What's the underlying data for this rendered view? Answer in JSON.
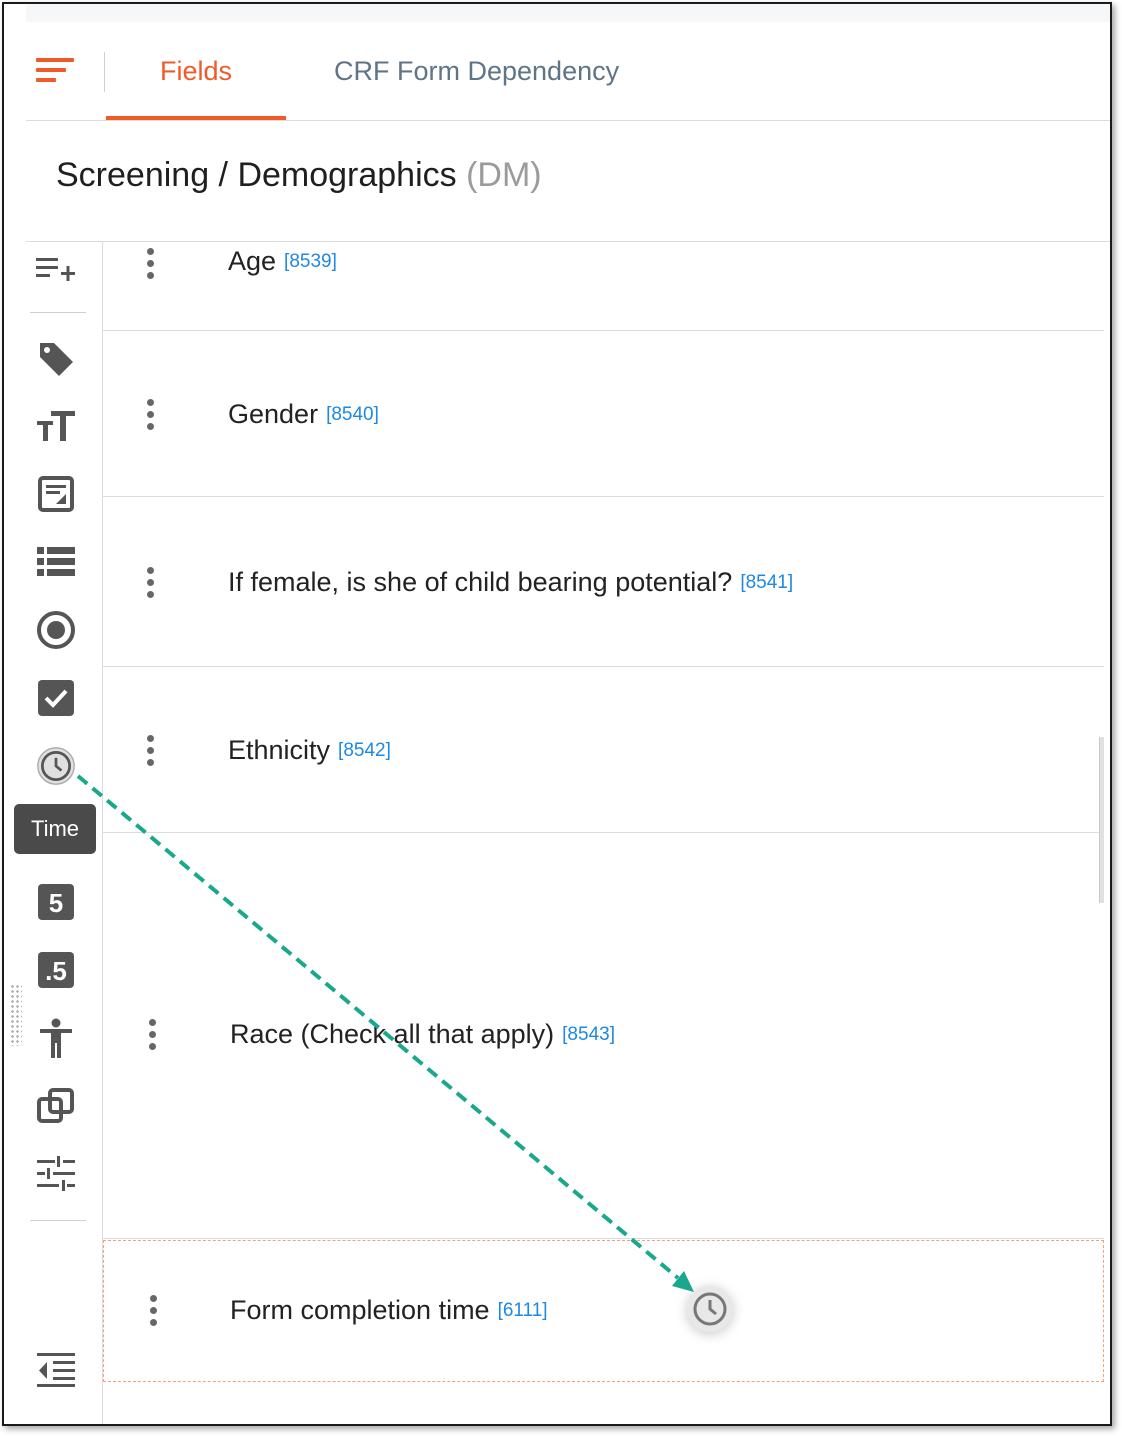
{
  "tabs": {
    "fields": "Fields",
    "dependency": "CRF Form Dependency"
  },
  "form": {
    "title": "Screening / Demographics",
    "code": "(DM)"
  },
  "toolbar": {
    "icons": [
      "add-field-icon",
      "tag-icon",
      "text-icon",
      "note-icon",
      "list-icon",
      "radio-icon",
      "checkbox-icon",
      "clock-icon",
      "calendar-icon",
      "integer-icon",
      "decimal-icon",
      "accessibility-icon",
      "copy-icon",
      "sliders-icon",
      "collapse-icon"
    ],
    "tooltip": "Time"
  },
  "fields": [
    {
      "label": "Age",
      "id": "[8539]"
    },
    {
      "label": "Gender",
      "id": "[8540]"
    },
    {
      "label": "If female, is she of child bearing potential?",
      "id": "[8541]"
    },
    {
      "label": "Ethnicity",
      "id": "[8542]"
    },
    {
      "label": "Race (Check all that apply)",
      "id": "[8543]"
    },
    {
      "label": "Form completion time",
      "id": "[6111]"
    }
  ],
  "colors": {
    "accent": "#f05a28",
    "id_link": "#1e88e5",
    "arrow": "#1aa88c"
  }
}
